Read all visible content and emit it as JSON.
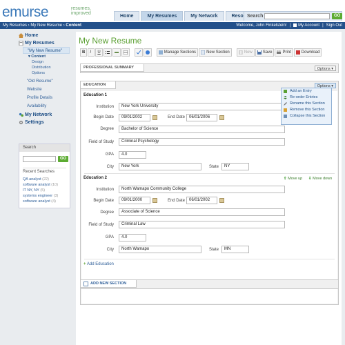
{
  "brand": {
    "logo": "emurse",
    "tagline_1": "resumes,",
    "tagline_2": "improved"
  },
  "nav": {
    "tabs": [
      "Home",
      "My Resumes",
      "My Network",
      "Resources"
    ],
    "active": "My Resumes"
  },
  "top_search": {
    "label": "Search",
    "go": "GO"
  },
  "breadcrumb": {
    "part1": "My Resumes",
    "sep": " › ",
    "part2": "My New Resume",
    "part3": "Content"
  },
  "userbar": {
    "welcome": "Welcome, John Finkelstein!",
    "account": "My Account",
    "signout": "Sign Out"
  },
  "sidebar": {
    "home": "Home",
    "my_resumes": "My Resumes",
    "selected_resume": "\"My New Resume\"",
    "content": "▾ Content",
    "content_items": [
      "Design",
      "Distribution",
      "Options"
    ],
    "old_resume": "\"Old Resume\"",
    "links": [
      "Website",
      "Profile Details",
      "Availability"
    ],
    "my_network": "My Network",
    "settings": "Settings"
  },
  "search_box": {
    "title": "Search",
    "go": "GO",
    "recent_label": "Recent Searches",
    "recent": [
      {
        "term": "QA analyst",
        "count": "(22)"
      },
      {
        "term": "software analyst",
        "count": "(10)"
      },
      {
        "term": "IT NY, NY",
        "count": "(5)"
      },
      {
        "term": "systems engineer",
        "count": "(3)"
      },
      {
        "term": "software analyst",
        "count": "(4)"
      }
    ]
  },
  "main": {
    "title": "My New Resume",
    "toolbar": {
      "bold": "B",
      "italic": "I",
      "underline": "U",
      "manage": "Manage Sections",
      "new_section": "New Section",
      "new": "New",
      "save": "Save",
      "print": "Print",
      "download": "Download"
    },
    "summary": {
      "tab": "PROFESSIONAL SUMMARY",
      "options": "Options ▾"
    },
    "education": {
      "tab": "EDUCATION",
      "options": "Options ▾",
      "labels": {
        "institution": "Institution",
        "begin": "Begin Date",
        "end": "End Date",
        "degree": "Degree",
        "field": "Field of Study",
        "gpa": "GPA",
        "city": "City",
        "state": "State"
      },
      "entries": [
        {
          "heading": "Education 1",
          "institution": "New York University",
          "begin": "09/01/2002",
          "end": "06/01/2006",
          "degree": "Bachelor of Science",
          "field": "Criminal Psychology",
          "gpa": "4.0",
          "city": "New York",
          "state": "NY"
        },
        {
          "heading": "Education 2",
          "institution": "North Wamapo Community College",
          "begin": "09/01/2000",
          "end": "06/01/2002",
          "degree": "Associate of Science",
          "field": "Criminal Law",
          "gpa": "4.0",
          "city": "North Wamapo",
          "state": "MN"
        }
      ],
      "move_up": "Move up",
      "move_down": "Move down",
      "add": "Add Education"
    },
    "options_menu": [
      "Add an Entry",
      "Re-order Entries",
      "Rename this Section",
      "Remove this Section",
      "Collapse this Section"
    ],
    "add_section": "ADD NEW SECTION"
  }
}
